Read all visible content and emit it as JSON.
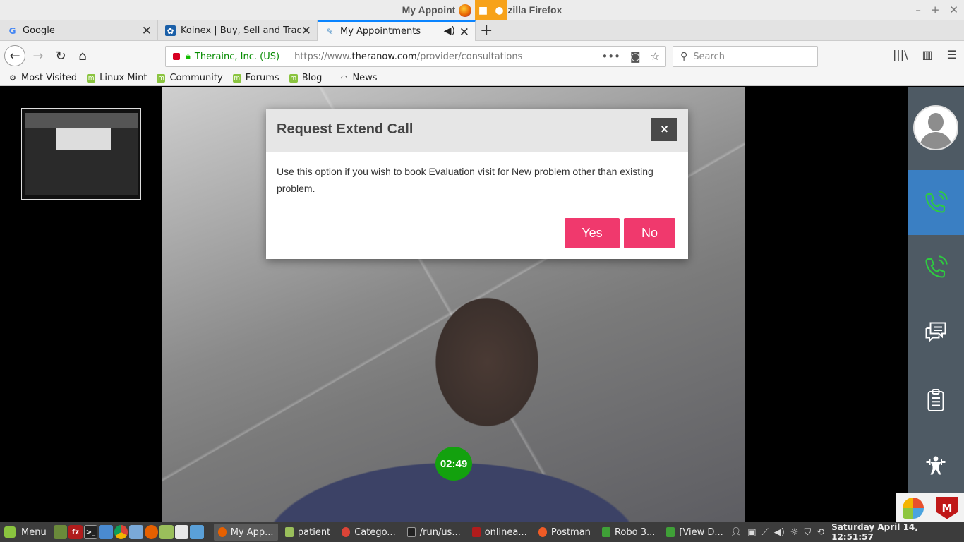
{
  "window": {
    "title": "My Appointments - Mozilla Firefox",
    "title_visible_left": "My Appoint",
    "title_visible_right": "zilla Firefox"
  },
  "tabs": [
    {
      "label": "Google",
      "icon": "google-icon",
      "active": false
    },
    {
      "label": "Koinex | Buy, Sell and Trade E",
      "icon": "koinex-icon",
      "active": false
    },
    {
      "label": "My Appointments",
      "icon": "theranow-icon",
      "active": true,
      "audio": true
    }
  ],
  "nav": {
    "identity": "Therainc, Inc. (US)",
    "url_prefix": "https://www.",
    "url_domain": "theranow.com",
    "url_path": "/provider/consultations",
    "search_placeholder": "Search"
  },
  "bookmarks": [
    {
      "label": "Most Visited",
      "icon": "gear-icon"
    },
    {
      "label": "Linux Mint",
      "icon": "mint-icon"
    },
    {
      "label": "Community",
      "icon": "mint-icon"
    },
    {
      "label": "Forums",
      "icon": "mint-icon"
    },
    {
      "label": "Blog",
      "icon": "mint-icon"
    },
    {
      "label": "News",
      "icon": "rss-icon"
    }
  ],
  "call": {
    "timer": "02:49"
  },
  "modal": {
    "title": "Request Extend Call",
    "close_label": "×",
    "body": "Use this option if you wish to book Evaluation visit for New problem other than existing problem.",
    "yes_label": "Yes",
    "no_label": "No"
  },
  "sidebar": {
    "items": [
      {
        "name": "call-active",
        "icon": "phone-ringing-icon",
        "active": true
      },
      {
        "name": "call",
        "icon": "phone-ringing-icon",
        "active": false
      },
      {
        "name": "chat",
        "icon": "chat-icon",
        "active": false
      },
      {
        "name": "notes",
        "icon": "clipboard-icon",
        "active": false
      },
      {
        "name": "exercise",
        "icon": "exercise-icon",
        "active": false
      }
    ]
  },
  "taskbar": {
    "menu_label": "Menu",
    "tasks": [
      {
        "label": "My App...",
        "active": true
      },
      {
        "label": "patient",
        "active": false
      },
      {
        "label": "Catego...",
        "active": false
      },
      {
        "label": "/run/us...",
        "active": false
      },
      {
        "label": "onlinea...",
        "active": false
      },
      {
        "label": "Postman",
        "active": false
      },
      {
        "label": "Robo 3...",
        "active": false
      },
      {
        "label": "[View D...",
        "active": false
      }
    ],
    "clock": "Saturday April 14, 12:51:57"
  },
  "colors": {
    "accent_pink": "#f0396d",
    "sidebar_bg": "#4e5a64",
    "sidebar_active": "#3a7fc3",
    "timer_green": "#13a10e",
    "icon_green": "#2ecc40"
  }
}
